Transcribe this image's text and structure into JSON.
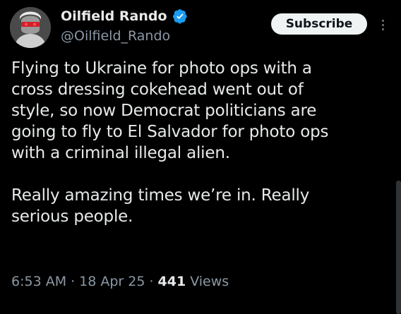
{
  "author": {
    "display_name": "Oilfield Rando",
    "handle": "@Oilfield_Rando",
    "verified": true,
    "verified_color": "#1d9bf0"
  },
  "actions": {
    "subscribe_label": "Subscribe",
    "more_icon": "more-vertical-icon"
  },
  "tweet": {
    "paragraph_1": "Flying to Ukraine for photo ops with a\ncross dressing cokehead went out of\nstyle, so now Democrat politicians are\ngoing to fly to El Salvador for photo ops\nwith a criminal illegal alien.",
    "paragraph_2": "Really amazing times we’re in. Really\nserious people."
  },
  "meta": {
    "time": "6:53 AM",
    "separator": "·",
    "date": "18 Apr 25",
    "views_count": "441",
    "views_label": "Views"
  },
  "colors": {
    "background": "#000000",
    "text": "#e7e9ea",
    "secondary_text": "#8b98a5",
    "button_bg": "#eff3f4",
    "button_text": "#0f1419"
  }
}
